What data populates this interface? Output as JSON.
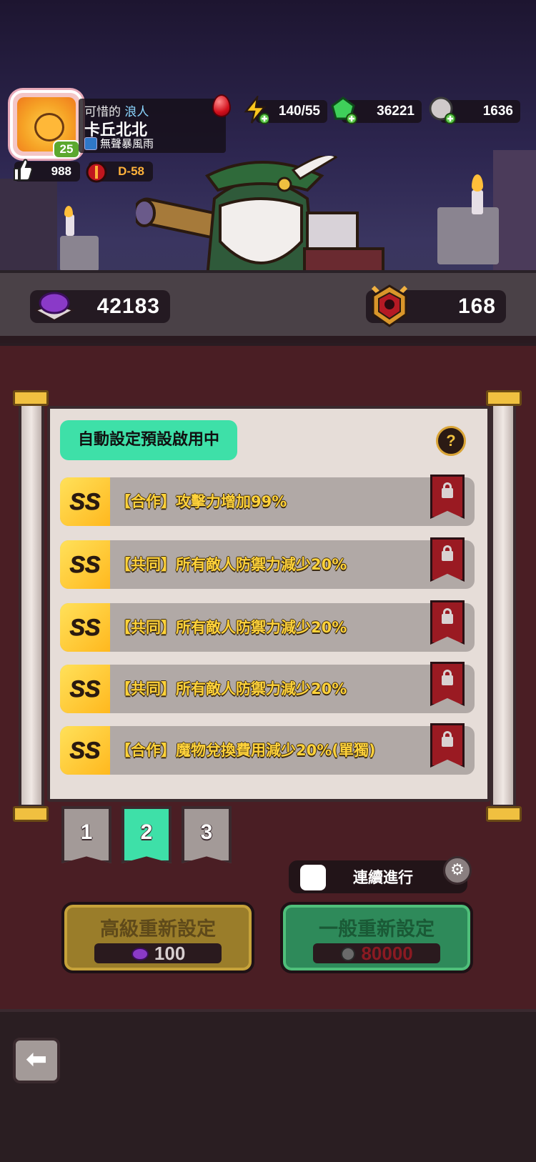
{
  "player": {
    "title_prefix": "可惜的",
    "title_class": "浪人",
    "name": "卡丘北北",
    "guild": "無聲暴風雨",
    "level": "25",
    "likes": "988",
    "stage": "D-58"
  },
  "resources": {
    "energy": "140/55",
    "gems": "36221",
    "coins": "1636"
  },
  "currency": {
    "purple_dust": "42183",
    "medal": "168"
  },
  "preset": {
    "auto_label": "自動設定預設啟用中",
    "help_symbol": "?"
  },
  "options": [
    {
      "grade": "SS",
      "text": "【合作】攻擊力增加99%"
    },
    {
      "grade": "SS",
      "text": "【共同】所有敵人防禦力減少20%"
    },
    {
      "grade": "SS",
      "text": "【共同】所有敵人防禦力減少20%"
    },
    {
      "grade": "SS",
      "text": "【共同】所有敵人防禦力減少20%"
    },
    {
      "grade": "SS",
      "text": "【合作】魔物兌換費用減少20%(單獨)"
    }
  ],
  "tabs": [
    "1",
    "2",
    "3"
  ],
  "active_tab": 2,
  "continuous": {
    "label": "連續進行"
  },
  "buttons": {
    "advanced": {
      "label": "高級重新設定",
      "cost": "100"
    },
    "normal": {
      "label": "一般重新設定",
      "cost": "80000"
    }
  },
  "colors": {
    "accent_teal": "#3ee0a8",
    "grade_gold": "#ffb81e",
    "lock_red": "#9a1a22",
    "background": "#4a1e24"
  }
}
